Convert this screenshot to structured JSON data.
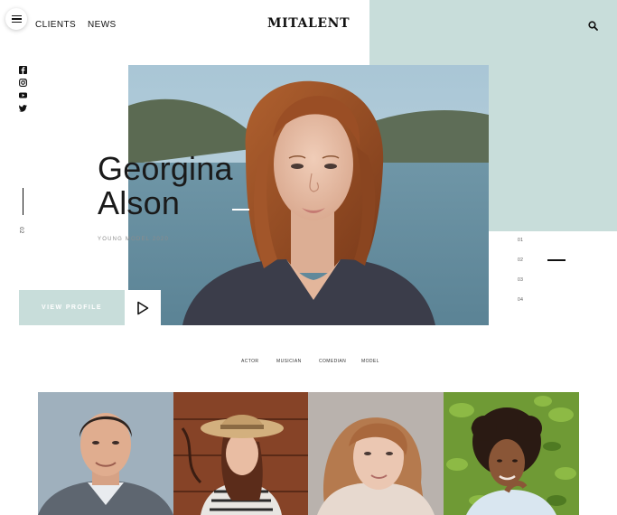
{
  "header": {
    "menu_icon": "hamburger-menu-icon",
    "nav": [
      "CLIENTS",
      "NEWS"
    ],
    "logo": "MITALENT",
    "search_icon": "search-icon"
  },
  "social_icons": [
    "facebook-icon",
    "instagram-icon",
    "youtube-icon",
    "twitter-icon"
  ],
  "hero": {
    "title_line1": "Georgina",
    "title_line2": "Alson",
    "subtitle": "YOUNG MODEL 2020",
    "slide_current": "02",
    "cta_label": "VIEW PROFILE",
    "play_icon": "play-icon",
    "slide_numbers": [
      "01",
      "02",
      "03",
      "04"
    ],
    "active_slide": 2
  },
  "categories": [
    "ACTOR",
    "MUSICIAN",
    "COMEDIAN",
    "MODEL"
  ],
  "gallery": [
    {
      "name": "portrait-man"
    },
    {
      "name": "portrait-girl-hat"
    },
    {
      "name": "portrait-girl-freckles"
    },
    {
      "name": "portrait-girl-curly"
    }
  ],
  "colors": {
    "accent_mint": "#c8ddda",
    "text": "#111111",
    "muted": "#8c8c8c"
  }
}
